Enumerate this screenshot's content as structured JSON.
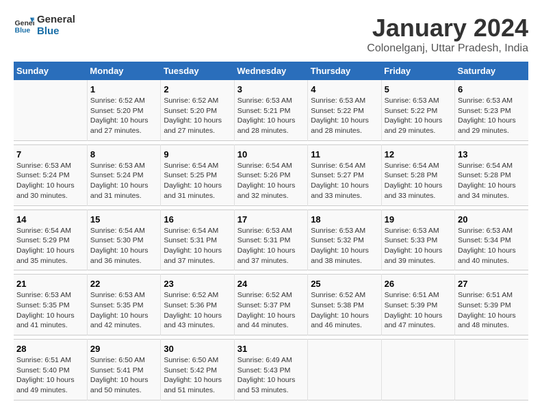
{
  "logo": {
    "general": "General",
    "blue": "Blue"
  },
  "title": "January 2024",
  "subtitle": "Colonelganj, Uttar Pradesh, India",
  "days_of_week": [
    "Sunday",
    "Monday",
    "Tuesday",
    "Wednesday",
    "Thursday",
    "Friday",
    "Saturday"
  ],
  "weeks": [
    [
      {
        "num": "",
        "sunrise": "",
        "sunset": "",
        "daylight": ""
      },
      {
        "num": "1",
        "sunrise": "Sunrise: 6:52 AM",
        "sunset": "Sunset: 5:20 PM",
        "daylight": "Daylight: 10 hours and 27 minutes."
      },
      {
        "num": "2",
        "sunrise": "Sunrise: 6:52 AM",
        "sunset": "Sunset: 5:20 PM",
        "daylight": "Daylight: 10 hours and 27 minutes."
      },
      {
        "num": "3",
        "sunrise": "Sunrise: 6:53 AM",
        "sunset": "Sunset: 5:21 PM",
        "daylight": "Daylight: 10 hours and 28 minutes."
      },
      {
        "num": "4",
        "sunrise": "Sunrise: 6:53 AM",
        "sunset": "Sunset: 5:22 PM",
        "daylight": "Daylight: 10 hours and 28 minutes."
      },
      {
        "num": "5",
        "sunrise": "Sunrise: 6:53 AM",
        "sunset": "Sunset: 5:22 PM",
        "daylight": "Daylight: 10 hours and 29 minutes."
      },
      {
        "num": "6",
        "sunrise": "Sunrise: 6:53 AM",
        "sunset": "Sunset: 5:23 PM",
        "daylight": "Daylight: 10 hours and 29 minutes."
      }
    ],
    [
      {
        "num": "7",
        "sunrise": "Sunrise: 6:53 AM",
        "sunset": "Sunset: 5:24 PM",
        "daylight": "Daylight: 10 hours and 30 minutes."
      },
      {
        "num": "8",
        "sunrise": "Sunrise: 6:53 AM",
        "sunset": "Sunset: 5:24 PM",
        "daylight": "Daylight: 10 hours and 31 minutes."
      },
      {
        "num": "9",
        "sunrise": "Sunrise: 6:54 AM",
        "sunset": "Sunset: 5:25 PM",
        "daylight": "Daylight: 10 hours and 31 minutes."
      },
      {
        "num": "10",
        "sunrise": "Sunrise: 6:54 AM",
        "sunset": "Sunset: 5:26 PM",
        "daylight": "Daylight: 10 hours and 32 minutes."
      },
      {
        "num": "11",
        "sunrise": "Sunrise: 6:54 AM",
        "sunset": "Sunset: 5:27 PM",
        "daylight": "Daylight: 10 hours and 33 minutes."
      },
      {
        "num": "12",
        "sunrise": "Sunrise: 6:54 AM",
        "sunset": "Sunset: 5:28 PM",
        "daylight": "Daylight: 10 hours and 33 minutes."
      },
      {
        "num": "13",
        "sunrise": "Sunrise: 6:54 AM",
        "sunset": "Sunset: 5:28 PM",
        "daylight": "Daylight: 10 hours and 34 minutes."
      }
    ],
    [
      {
        "num": "14",
        "sunrise": "Sunrise: 6:54 AM",
        "sunset": "Sunset: 5:29 PM",
        "daylight": "Daylight: 10 hours and 35 minutes."
      },
      {
        "num": "15",
        "sunrise": "Sunrise: 6:54 AM",
        "sunset": "Sunset: 5:30 PM",
        "daylight": "Daylight: 10 hours and 36 minutes."
      },
      {
        "num": "16",
        "sunrise": "Sunrise: 6:54 AM",
        "sunset": "Sunset: 5:31 PM",
        "daylight": "Daylight: 10 hours and 37 minutes."
      },
      {
        "num": "17",
        "sunrise": "Sunrise: 6:53 AM",
        "sunset": "Sunset: 5:31 PM",
        "daylight": "Daylight: 10 hours and 37 minutes."
      },
      {
        "num": "18",
        "sunrise": "Sunrise: 6:53 AM",
        "sunset": "Sunset: 5:32 PM",
        "daylight": "Daylight: 10 hours and 38 minutes."
      },
      {
        "num": "19",
        "sunrise": "Sunrise: 6:53 AM",
        "sunset": "Sunset: 5:33 PM",
        "daylight": "Daylight: 10 hours and 39 minutes."
      },
      {
        "num": "20",
        "sunrise": "Sunrise: 6:53 AM",
        "sunset": "Sunset: 5:34 PM",
        "daylight": "Daylight: 10 hours and 40 minutes."
      }
    ],
    [
      {
        "num": "21",
        "sunrise": "Sunrise: 6:53 AM",
        "sunset": "Sunset: 5:35 PM",
        "daylight": "Daylight: 10 hours and 41 minutes."
      },
      {
        "num": "22",
        "sunrise": "Sunrise: 6:53 AM",
        "sunset": "Sunset: 5:35 PM",
        "daylight": "Daylight: 10 hours and 42 minutes."
      },
      {
        "num": "23",
        "sunrise": "Sunrise: 6:52 AM",
        "sunset": "Sunset: 5:36 PM",
        "daylight": "Daylight: 10 hours and 43 minutes."
      },
      {
        "num": "24",
        "sunrise": "Sunrise: 6:52 AM",
        "sunset": "Sunset: 5:37 PM",
        "daylight": "Daylight: 10 hours and 44 minutes."
      },
      {
        "num": "25",
        "sunrise": "Sunrise: 6:52 AM",
        "sunset": "Sunset: 5:38 PM",
        "daylight": "Daylight: 10 hours and 46 minutes."
      },
      {
        "num": "26",
        "sunrise": "Sunrise: 6:51 AM",
        "sunset": "Sunset: 5:39 PM",
        "daylight": "Daylight: 10 hours and 47 minutes."
      },
      {
        "num": "27",
        "sunrise": "Sunrise: 6:51 AM",
        "sunset": "Sunset: 5:39 PM",
        "daylight": "Daylight: 10 hours and 48 minutes."
      }
    ],
    [
      {
        "num": "28",
        "sunrise": "Sunrise: 6:51 AM",
        "sunset": "Sunset: 5:40 PM",
        "daylight": "Daylight: 10 hours and 49 minutes."
      },
      {
        "num": "29",
        "sunrise": "Sunrise: 6:50 AM",
        "sunset": "Sunset: 5:41 PM",
        "daylight": "Daylight: 10 hours and 50 minutes."
      },
      {
        "num": "30",
        "sunrise": "Sunrise: 6:50 AM",
        "sunset": "Sunset: 5:42 PM",
        "daylight": "Daylight: 10 hours and 51 minutes."
      },
      {
        "num": "31",
        "sunrise": "Sunrise: 6:49 AM",
        "sunset": "Sunset: 5:43 PM",
        "daylight": "Daylight: 10 hours and 53 minutes."
      },
      {
        "num": "",
        "sunrise": "",
        "sunset": "",
        "daylight": ""
      },
      {
        "num": "",
        "sunrise": "",
        "sunset": "",
        "daylight": ""
      },
      {
        "num": "",
        "sunrise": "",
        "sunset": "",
        "daylight": ""
      }
    ]
  ]
}
